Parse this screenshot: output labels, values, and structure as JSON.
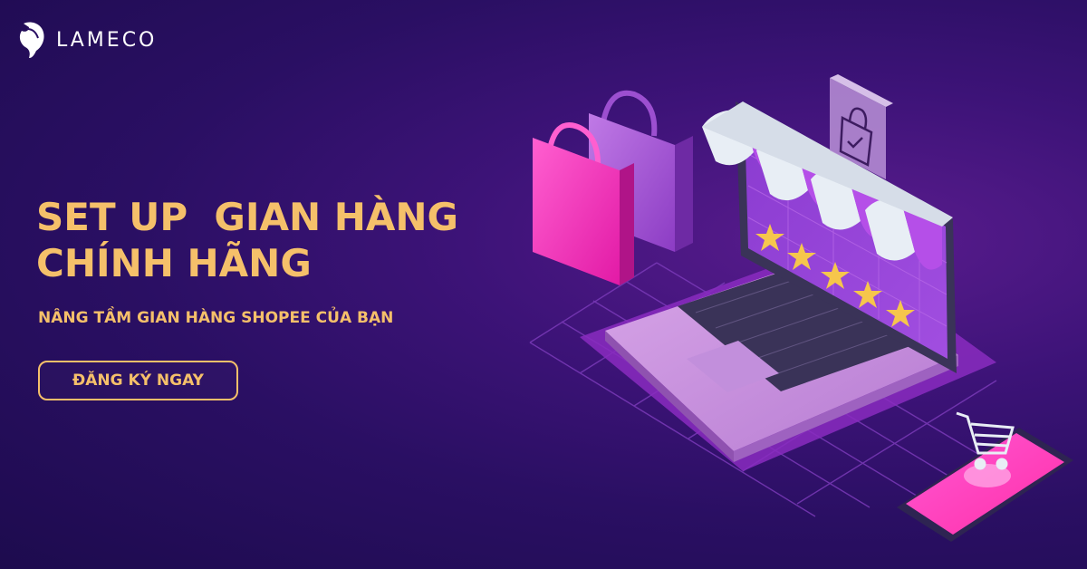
{
  "brand": {
    "name": "LAMECO"
  },
  "hero": {
    "headline_line1": "SET UP  GIAN HÀNG",
    "headline_line2": "CHÍNH HÃNG",
    "subheadline": "NÂNG TẦM GIAN HÀNG SHOPEE CỦA BẠN"
  },
  "cta": {
    "label": "ĐĂNG KÝ NGAY"
  },
  "colors": {
    "background": "#2a0f63",
    "accent_gold": "#f5c06a",
    "magenta": "#ff3cc0",
    "violet": "#a94fd6"
  },
  "illustration": {
    "star_count": 5,
    "icons": [
      "laptop-icon",
      "shopping-bag-icon",
      "storefront-awning-icon",
      "star-icon",
      "smartphone-icon",
      "shopping-cart-icon",
      "bag-check-icon"
    ]
  }
}
